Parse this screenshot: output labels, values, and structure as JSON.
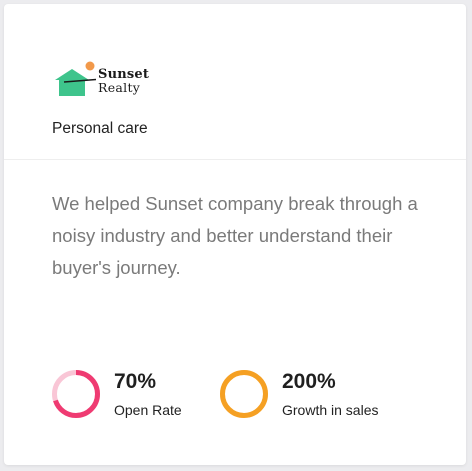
{
  "card": {
    "logo": {
      "line1": "Sunset",
      "line2": "Realty",
      "house_color": "#3ec48c",
      "sun_color": "#f2994a"
    },
    "category": "Personal care",
    "description": "We helped Sunset company break through a noisy industry and better understand their buyer's journey.",
    "stats": [
      {
        "value": "70%",
        "label": "Open Rate",
        "progress": 0.7,
        "color": "#ef3b72",
        "track_color": "#f9c6d6"
      },
      {
        "value": "200%",
        "label": "Growth in sales",
        "progress": 1.0,
        "color": "#f5a023",
        "track_color": "#fde3b8"
      }
    ]
  }
}
